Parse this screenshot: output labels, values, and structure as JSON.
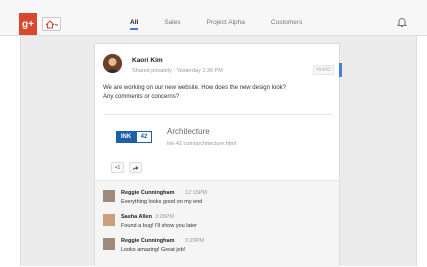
{
  "header": {
    "logo": "g+",
    "tabs": [
      {
        "label": "All",
        "active": true
      },
      {
        "label": "Sales",
        "active": false
      },
      {
        "label": "Project Alpha",
        "active": false
      },
      {
        "label": "Customers",
        "active": false
      }
    ],
    "bell_icon": "bell-icon",
    "home_icon": "home-icon"
  },
  "post": {
    "author": "Kaori Kim",
    "meta": "Shared privately  -  Yesterday 1:36 PM",
    "tag": "#ink42",
    "text_line1": "We are working on our new website. How does the new design look?",
    "text_line2": "Any comments or concerns?",
    "link": {
      "logo_left": "INK",
      "logo_right": "42",
      "title": "Architecture",
      "url": "ink-42.com/architecture.html"
    },
    "plus_one": "+1",
    "share_icon": "share-icon"
  },
  "comments": [
    {
      "name": "Reggie Cunningham",
      "time": "12:15PM",
      "text": "Everything looks good on my end"
    },
    {
      "name": "Sasha Allen",
      "time": "3:05PM",
      "text": "Found a bug! I'll show you later"
    },
    {
      "name": "Reggie Cunningham",
      "time": "3:20PM",
      "text": "Looks amazing! Great job!"
    }
  ],
  "colors": {
    "brand_red": "#d9482e",
    "accent_blue": "#4a7ed8",
    "link_blue": "#1f5fa8"
  }
}
